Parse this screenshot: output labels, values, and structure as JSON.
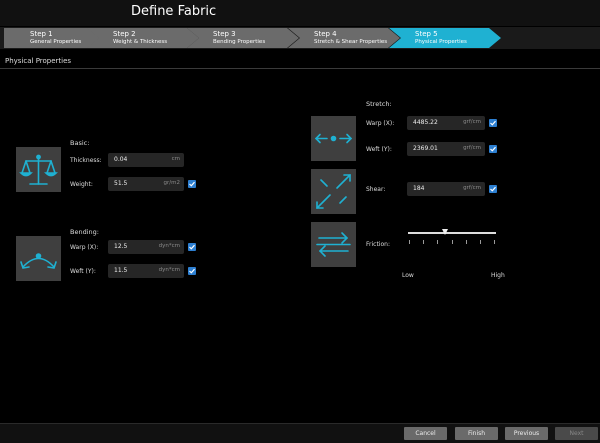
{
  "window": {
    "title": "Define Fabric"
  },
  "steps": [
    {
      "num": "Step   1",
      "name": "General Properties"
    },
    {
      "num": "Step   2",
      "name": "Weight & Thickness"
    },
    {
      "num": "Step   3",
      "name": "Bending Properties"
    },
    {
      "num": "Step   4",
      "name": "Stretch & Shear Properties"
    },
    {
      "num": "Step   5",
      "name": "Physical Properties"
    }
  ],
  "section": {
    "title": "Physical Properties"
  },
  "basic": {
    "title": "Basic:",
    "thickness": {
      "label": "Thickness:",
      "value": "0.04",
      "unit": "cm"
    },
    "weight": {
      "label": "Weight:",
      "value": "51.5",
      "unit": "gr/m2",
      "checked": true
    }
  },
  "bending": {
    "title": "Bending:",
    "warp": {
      "label": "Warp (X):",
      "value": "12.5",
      "unit": "dyn*cm",
      "checked": true
    },
    "weft": {
      "label": "Weft (Y):",
      "value": "11.5",
      "unit": "dyn*cm",
      "checked": true
    }
  },
  "stretch": {
    "title": "Stretch:",
    "warp": {
      "label": "Warp (X):",
      "value": "4485.22",
      "unit": "grf/cm",
      "checked": true
    },
    "weft": {
      "label": "Weft (Y):",
      "value": "2369.01",
      "unit": "grf/cm",
      "checked": true
    }
  },
  "shear": {
    "label": "Shear:",
    "value": "184",
    "unit": "grf/cm",
    "checked": true
  },
  "friction": {
    "label": "Friction:",
    "low": "Low",
    "high": "High",
    "level": 0.42
  },
  "buttons": {
    "cancel": "Cancel",
    "finish": "Finish",
    "previous": "Previous",
    "next": "Next"
  },
  "colors": {
    "accent": "#1fb1d2",
    "checkbox": "#2d7fd1"
  },
  "icons": [
    "scale-icon",
    "bending-icon",
    "stretch-icon",
    "diagonal-arrows-icon",
    "friction-icon"
  ]
}
